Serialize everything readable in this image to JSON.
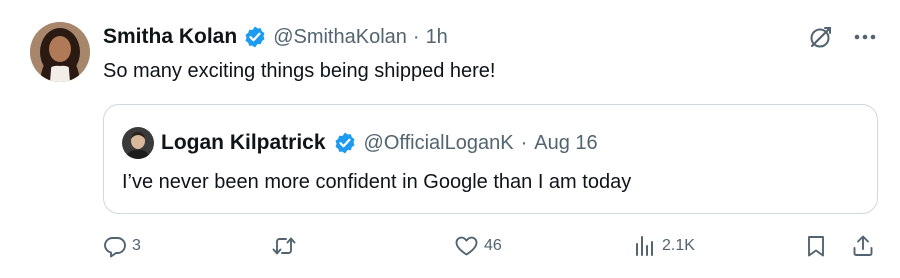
{
  "tweet": {
    "author_name": "Smitha Kolan",
    "handle": "@SmithaKolan",
    "separator": "·",
    "time": "1h",
    "text": "So many exciting things being shipped here!",
    "avatar_icon": "profile-photo",
    "verified_color": "#1d9bf0"
  },
  "quoted": {
    "author_name": "Logan Kilpatrick",
    "handle": "@OfficialLoganK",
    "separator": "·",
    "date": "Aug 16",
    "text": "I’ve never been more confident in Google than I am today",
    "avatar_icon": "profile-photo"
  },
  "actions": {
    "reply_count": "3",
    "repost_count": "",
    "like_count": "46",
    "views_count": "2.1K"
  },
  "icons": {
    "top_right": [
      "grok-icon",
      "more-icon"
    ],
    "action_bar": [
      "reply-icon",
      "repost-icon",
      "like-icon",
      "views-icon",
      "bookmark-icon",
      "share-icon"
    ]
  },
  "colors": {
    "text": "#0f1419",
    "secondary": "#536471",
    "border": "#cfd9de",
    "accent": "#1d9bf0"
  }
}
